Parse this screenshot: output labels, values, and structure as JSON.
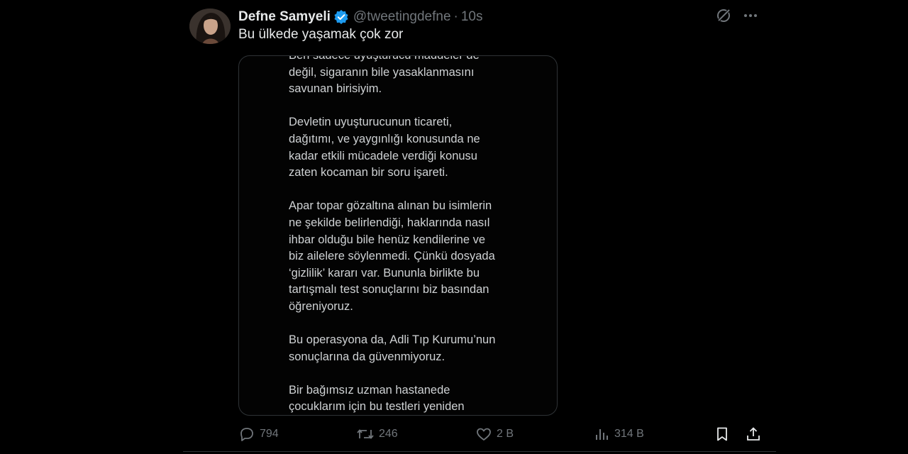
{
  "tweet": {
    "display_name": "Defne Samyeli",
    "handle": "@tweetingdefne",
    "separator": "·",
    "time": "10s",
    "text": "Bu ülkede yaşamak çok zor",
    "verified_color": "#1d9bf0",
    "media_paragraphs": [
      "Ben sadece uyuşturucu maddeler de\ndeğil, sigaranın bile yasaklanmasını\nsavunan birisiyim.",
      "Devletin uyuşturucunun ticareti,\ndağıtımı, ve yaygınlığı konusunda ne\nkadar etkili mücadele verdiği konusu\nzaten kocaman bir soru işareti.",
      "",
      "Apar topar gözaltına alınan bu isimlerin\nne şekilde belirlendiği, haklarında nasıl\nihbar olduğu bile henüz kendilerine ve\nbiz ailelere söylenmedi. Çünkü dosyada\n‘gizlilik’ kararı var. Bununla birlikte bu\ntartışmalı test sonuçlarını biz basından\nöğreniyoruz.",
      "Bu operasyona da, Adli Tıp Kurumu’nun\nsonuçlarına da güvenmiyoruz.",
      "Bir bağımsız uzman hastanede\nçocuklarım için bu testleri yeniden"
    ]
  },
  "actions": {
    "replies": "794",
    "retweets": "246",
    "likes": "2 B",
    "views": "314 B"
  }
}
